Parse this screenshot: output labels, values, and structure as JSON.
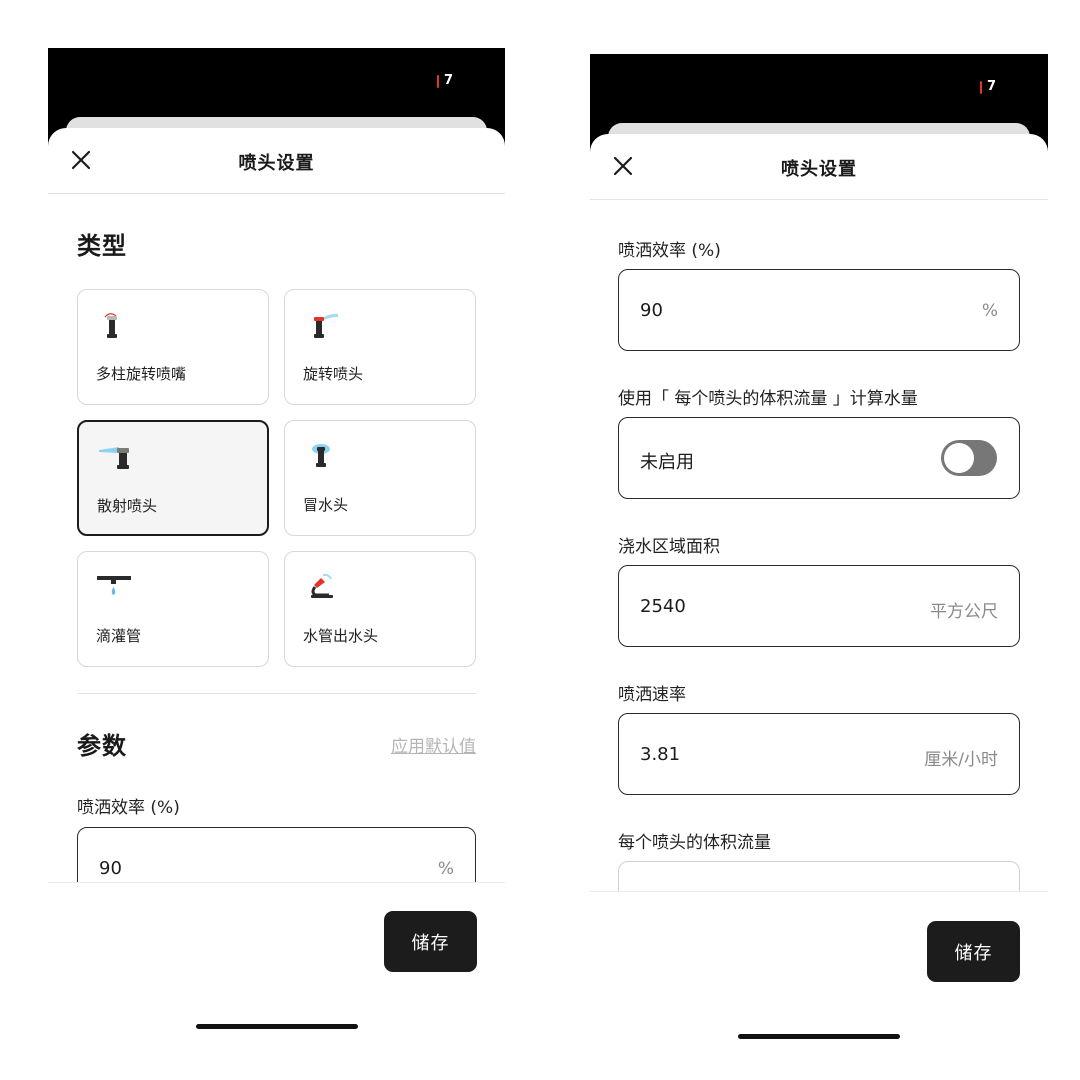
{
  "status_bar": {
    "badge": "7"
  },
  "sheet": {
    "title": "喷头设置"
  },
  "type_section": {
    "title": "类型",
    "items": [
      {
        "label": "多柱旋转喷嘴",
        "selected": false
      },
      {
        "label": "旋转喷头",
        "selected": false
      },
      {
        "label": "散射喷头",
        "selected": true
      },
      {
        "label": "冒水头",
        "selected": false
      },
      {
        "label": "滴灌管",
        "selected": false
      },
      {
        "label": "水管出水头",
        "selected": false
      }
    ]
  },
  "params_section": {
    "title": "参数",
    "default_link": "应用默认值"
  },
  "fields": {
    "efficiency": {
      "label": "喷洒效率 (%)",
      "value": "90",
      "unit": "%"
    },
    "use_flow": {
      "label": "使用「 每个喷头的体积流量 」计算水量",
      "value": "未启用",
      "enabled": false
    },
    "area": {
      "label": "浇水区域面积",
      "value": "2540",
      "unit": "平方公尺"
    },
    "rate": {
      "label": "喷洒速率",
      "value": "3.81",
      "unit": "厘米/小时"
    },
    "flow": {
      "label": "每个喷头的体积流量"
    }
  },
  "footer": {
    "save_label": "储存"
  },
  "colors": {
    "accent_dark": "#1c1c1c",
    "status_red": "#e2342b",
    "toggle_off": "#777777"
  }
}
